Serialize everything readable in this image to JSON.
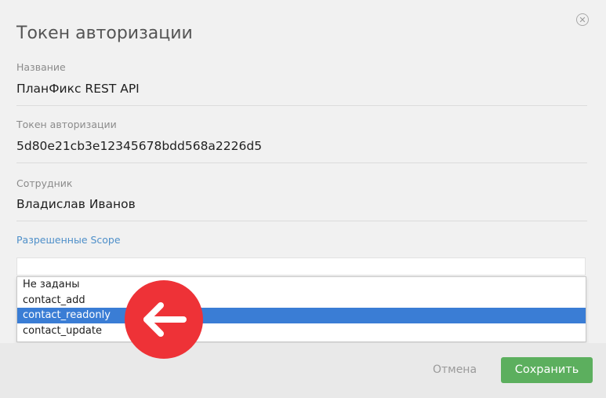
{
  "dialog": {
    "title": "Токен авторизации",
    "close_icon": "close-icon"
  },
  "fields": {
    "name": {
      "label": "Название",
      "value": "ПланФикс REST API"
    },
    "token": {
      "label": "Токен авторизации",
      "value": "5d80e21cb3e12345678bdd568a2226d5"
    },
    "employee": {
      "label": "Сотрудник",
      "value": "Владислав Иванов"
    }
  },
  "scope": {
    "label": "Разрешенные Scope",
    "selected": "contact_readonly",
    "options": [
      "Не заданы",
      "contact_add",
      "contact_readonly",
      "contact_update"
    ]
  },
  "footer": {
    "cancel_label": "Отмена",
    "save_label": "Сохранить"
  },
  "annotation": {
    "icon": "arrow-left-icon",
    "color": "#ee3237"
  },
  "colors": {
    "accent_link": "#4e8fc9",
    "selected_option": "#3a7dd5",
    "save_button": "#5caf5e"
  }
}
